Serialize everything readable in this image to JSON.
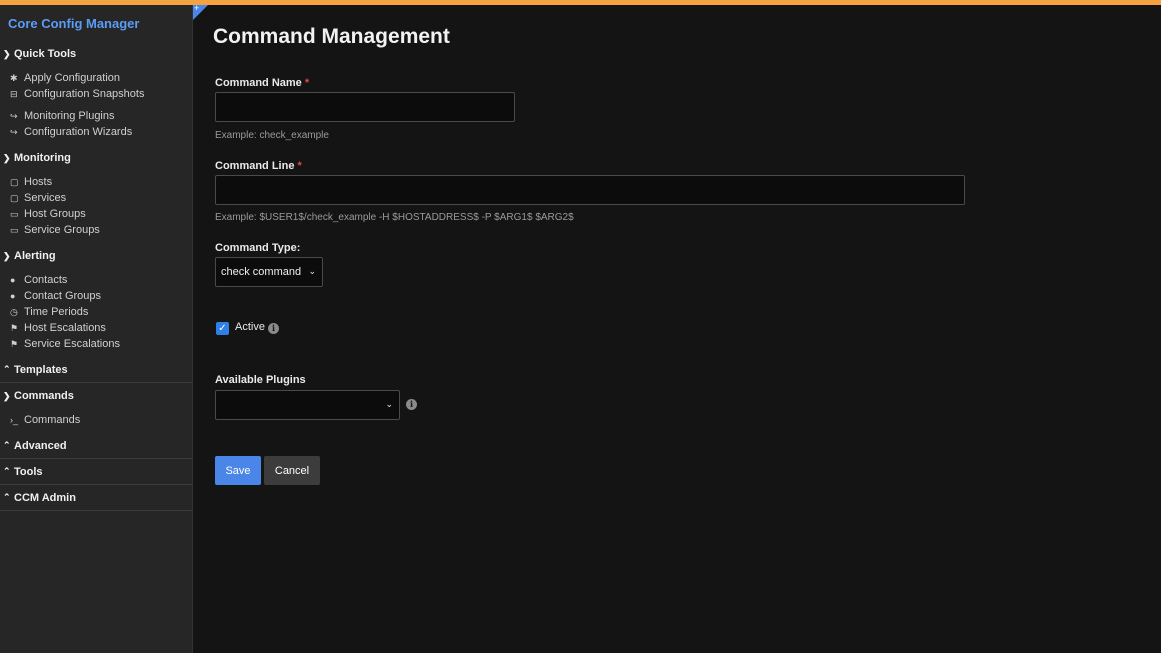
{
  "app": {
    "title": "Core Config Manager"
  },
  "sidebar": {
    "sections": [
      {
        "label": "Quick Tools",
        "expanded": true,
        "items": [
          {
            "label": "Apply Configuration",
            "icon": "asterisk-icon"
          },
          {
            "label": "Configuration Snapshots",
            "icon": "archive-icon"
          },
          {
            "label": "Monitoring Plugins",
            "icon": "share-icon"
          },
          {
            "label": "Configuration Wizards",
            "icon": "share-icon"
          }
        ]
      },
      {
        "label": "Monitoring",
        "expanded": true,
        "items": [
          {
            "label": "Hosts",
            "icon": "note-icon"
          },
          {
            "label": "Services",
            "icon": "note-icon"
          },
          {
            "label": "Host Groups",
            "icon": "folder-icon"
          },
          {
            "label": "Service Groups",
            "icon": "folder-icon"
          }
        ]
      },
      {
        "label": "Alerting",
        "expanded": true,
        "items": [
          {
            "label": "Contacts",
            "icon": "user-icon"
          },
          {
            "label": "Contact Groups",
            "icon": "users-icon"
          },
          {
            "label": "Time Periods",
            "icon": "clock-icon"
          },
          {
            "label": "Host Escalations",
            "icon": "flag-icon"
          },
          {
            "label": "Service Escalations",
            "icon": "flag-icon"
          }
        ]
      },
      {
        "label": "Templates",
        "expanded": false,
        "items": []
      },
      {
        "label": "Commands",
        "expanded": true,
        "items": [
          {
            "label": "Commands",
            "icon": "terminal-icon"
          }
        ]
      },
      {
        "label": "Advanced",
        "expanded": false,
        "items": []
      },
      {
        "label": "Tools",
        "expanded": false,
        "items": []
      },
      {
        "label": "CCM Admin",
        "expanded": false,
        "items": []
      }
    ]
  },
  "main": {
    "title": "Command Management",
    "command_name": {
      "label": "Command Name",
      "required": "*",
      "value": "",
      "hint": "Example: check_example"
    },
    "command_line": {
      "label": "Command Line",
      "required": "*",
      "value": "",
      "hint": "Example: $USER1$/check_example -H $HOSTADDRESS$ -P $ARG1$ $ARG2$"
    },
    "command_type": {
      "label": "Command Type:",
      "selected": "check command"
    },
    "active": {
      "label": "Active",
      "checked": true
    },
    "plugins": {
      "label": "Available Plugins",
      "selected": ""
    },
    "save_label": "Save",
    "cancel_label": "Cancel"
  },
  "colors": {
    "accent_bar": "#f5a340",
    "primary": "#4a86e8",
    "link": "#5b9cf5",
    "required": "#e04848"
  }
}
